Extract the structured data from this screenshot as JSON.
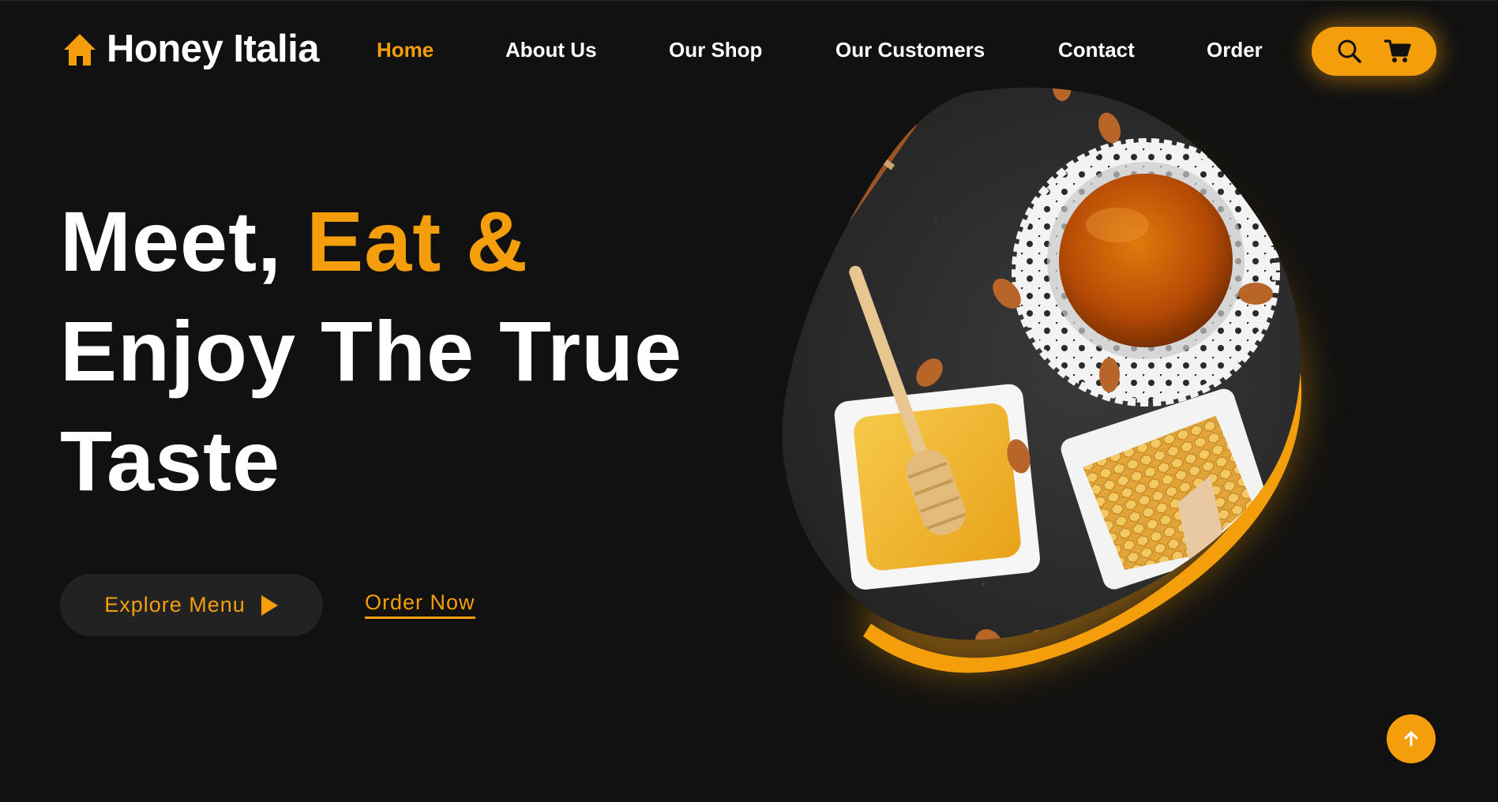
{
  "brand": {
    "name": "Honey Italia",
    "icon": "home-icon"
  },
  "nav": {
    "items": [
      {
        "label": "Home",
        "active": true
      },
      {
        "label": "About Us",
        "active": false
      },
      {
        "label": "Our Shop",
        "active": false
      },
      {
        "label": "Our Customers",
        "active": false
      },
      {
        "label": "Contact",
        "active": false
      },
      {
        "label": "Order",
        "active": false
      }
    ],
    "actions": [
      {
        "icon": "search-icon"
      },
      {
        "icon": "cart-icon"
      }
    ]
  },
  "hero": {
    "title_line1_white": "Meet,",
    "title_line1_accent": "Eat &",
    "title_line2": "Enjoy The True",
    "title_line3": "Taste",
    "primary_cta": "Explore Menu",
    "primary_cta_icon": "play-triangle-icon",
    "secondary_cta": "Order Now",
    "image_icon": "honey-photo"
  },
  "scroll_top_icon": "arrow-up-icon",
  "colors": {
    "accent": "#f59e0b",
    "background": "#111111",
    "button_dark": "#222222",
    "text": "#ffffff"
  }
}
